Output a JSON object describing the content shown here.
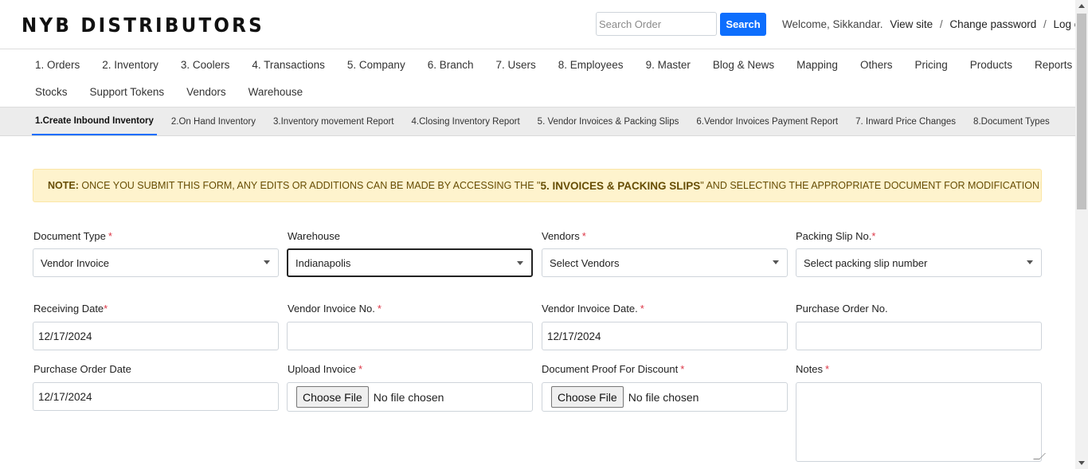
{
  "header": {
    "brand": "NYB DISTRIBUTORS",
    "search": {
      "placeholder": "Search Order",
      "button": "Search"
    },
    "welcome": "Welcome, Sikkandar.",
    "links": [
      "View site",
      "Change password",
      "Log out"
    ],
    "separator": "/"
  },
  "main_nav": {
    "row1": [
      "1. Orders",
      "2. Inventory",
      "3. Coolers",
      "4. Transactions",
      "5. Company",
      "6. Branch",
      "7. Users",
      "8. Employees",
      "9. Master",
      "Blog & News",
      "Mapping",
      "Others",
      "Pricing",
      "Products",
      "Reports"
    ],
    "row2": [
      "Stocks",
      "Support Tokens",
      "Vendors",
      "Warehouse"
    ]
  },
  "sub_nav": {
    "tabs": [
      "1.Create Inbound Inventory",
      "2.On Hand Inventory",
      "3.Inventory movement Report",
      "4.Closing Inventory Report",
      "5. Vendor Invoices & Packing Slips",
      "6.Vendor Invoices Payment Report",
      "7. Inward Price Changes",
      "8.Document Types"
    ],
    "active": "1.Create Inbound Inventory"
  },
  "note": {
    "prefix": "NOTE:",
    "text_before": " ONCE YOU SUBMIT THIS FORM, ANY EDITS OR ADDITIONS CAN BE MADE BY ACCESSING THE \"",
    "highlight": "5. INVOICES & PACKING SLIPS",
    "text_after": "\" AND SELECTING THE APPROPRIATE DOCUMENT FOR MODIFICATION"
  },
  "form": {
    "document_type": {
      "label": "Document Type",
      "required": "*",
      "value": "Vendor Invoice"
    },
    "warehouse": {
      "label": "Warehouse",
      "value": "Indianapolis"
    },
    "vendors": {
      "label": "Vendors",
      "required": "*",
      "value": "Select Vendors"
    },
    "packing_slip": {
      "label": "Packing Slip No.",
      "required": "*",
      "value": "Select packing slip number"
    },
    "receiving_date": {
      "label": "Receiving Date",
      "required": "*",
      "value": "12/17/2024"
    },
    "vendor_invoice_no": {
      "label": "Vendor Invoice No.",
      "required": "*",
      "value": ""
    },
    "vendor_invoice_date": {
      "label": "Vendor Invoice Date.",
      "required": "*",
      "value": "12/17/2024"
    },
    "purchase_order_no": {
      "label": "Purchase Order No.",
      "value": ""
    },
    "purchase_order_date": {
      "label": "Purchase Order Date",
      "value": "12/17/2024"
    },
    "upload_invoice": {
      "label": "Upload Invoice",
      "required": "*",
      "button": "Choose File",
      "status": "No file chosen"
    },
    "document_proof": {
      "label": "Document Proof For Discount",
      "required": "*",
      "button": "Choose File",
      "status": "No file chosen"
    },
    "notes": {
      "label": "Notes",
      "required": "*",
      "value": ""
    }
  },
  "colors": {
    "primary": "#0d6efd",
    "note_bg": "#fef3cd",
    "note_text": "#664d03",
    "required": "#dc3545"
  }
}
